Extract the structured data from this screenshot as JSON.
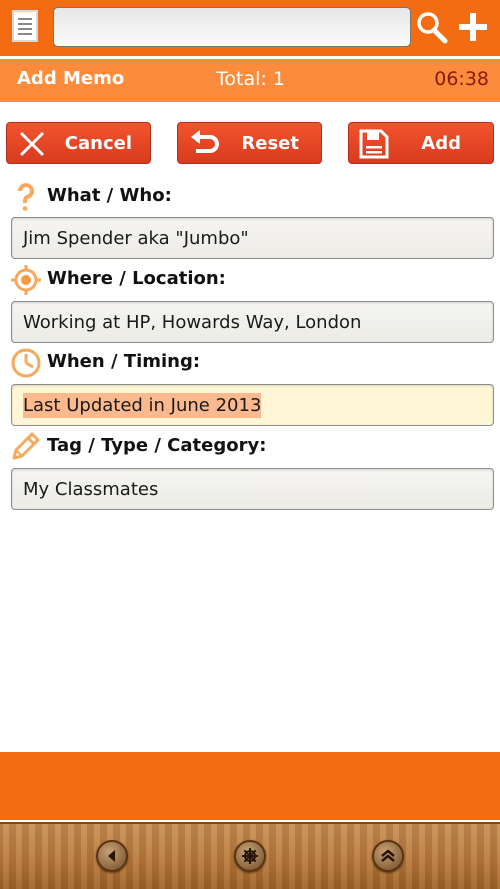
{
  "toolbar": {
    "search_value": "",
    "icons": [
      "list-icon",
      "search-icon",
      "plus-icon"
    ]
  },
  "titlebar": {
    "title": "Add Memo",
    "total": "Total: 1",
    "time": "06:38"
  },
  "actions": {
    "cancel_label": "Cancel",
    "reset_label": "Reset",
    "add_label": "Add"
  },
  "fields": [
    {
      "label": "What / Who:",
      "icon": "question-mark-icon",
      "value": "Jim Spender aka \"Jumbo\""
    },
    {
      "label": "Where / Location:",
      "icon": "location-target-icon",
      "value": "Working at HP, Howards Way, London"
    },
    {
      "label": "When / Timing:",
      "icon": "clock-icon",
      "value": "Last Updated in June 2013"
    },
    {
      "label": "Tag / Type / Category:",
      "icon": "pencil-tag-icon",
      "value": "My Classmates"
    }
  ],
  "colors": {
    "accent": "#f36c12",
    "accent_light": "#fc8c3c",
    "button_red": "#e44a25",
    "icon_orange": "#f6a85c"
  },
  "bottom_nav": [
    "back-icon",
    "helm-icon",
    "up-icon"
  ]
}
